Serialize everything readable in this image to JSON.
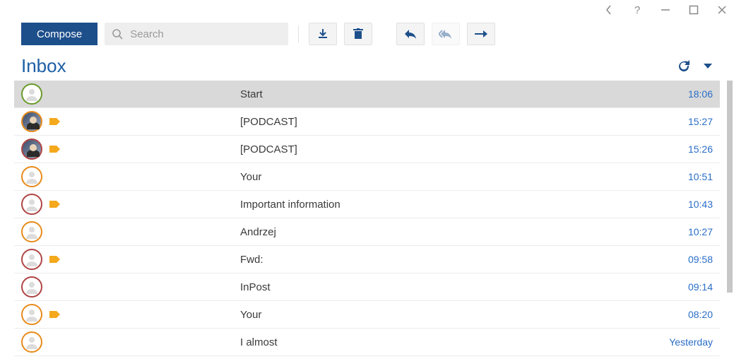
{
  "titlebar": {},
  "toolbar": {
    "compose_label": "Compose",
    "search_placeholder": "Search"
  },
  "folder": {
    "title": "Inbox"
  },
  "messages": [
    {
      "avatar": "ring-green",
      "tagged": false,
      "subject": "Start",
      "time": "18:06",
      "selected": true
    },
    {
      "avatar": "photo",
      "tagged": true,
      "subject": "[PODCAST]",
      "time": "15:27",
      "selected": false
    },
    {
      "avatar": "photo red",
      "tagged": true,
      "subject": "[PODCAST]",
      "time": "15:26",
      "selected": false
    },
    {
      "avatar": "ring-orange",
      "tagged": false,
      "subject": "Your",
      "time": "10:51",
      "selected": false
    },
    {
      "avatar": "ring-red",
      "tagged": true,
      "subject": "Important information",
      "time": "10:43",
      "selected": false
    },
    {
      "avatar": "ring-orange",
      "tagged": false,
      "subject": "Andrzej",
      "time": "10:27",
      "selected": false
    },
    {
      "avatar": "ring-red",
      "tagged": true,
      "subject": "Fwd:",
      "time": "09:58",
      "selected": false
    },
    {
      "avatar": "ring-red",
      "tagged": false,
      "subject": "InPost",
      "time": "09:14",
      "selected": false
    },
    {
      "avatar": "ring-orange",
      "tagged": true,
      "subject": "Your",
      "time": "08:20",
      "selected": false
    },
    {
      "avatar": "ring-orange",
      "tagged": false,
      "subject": "I almost",
      "time": "Yesterday",
      "selected": false
    }
  ]
}
